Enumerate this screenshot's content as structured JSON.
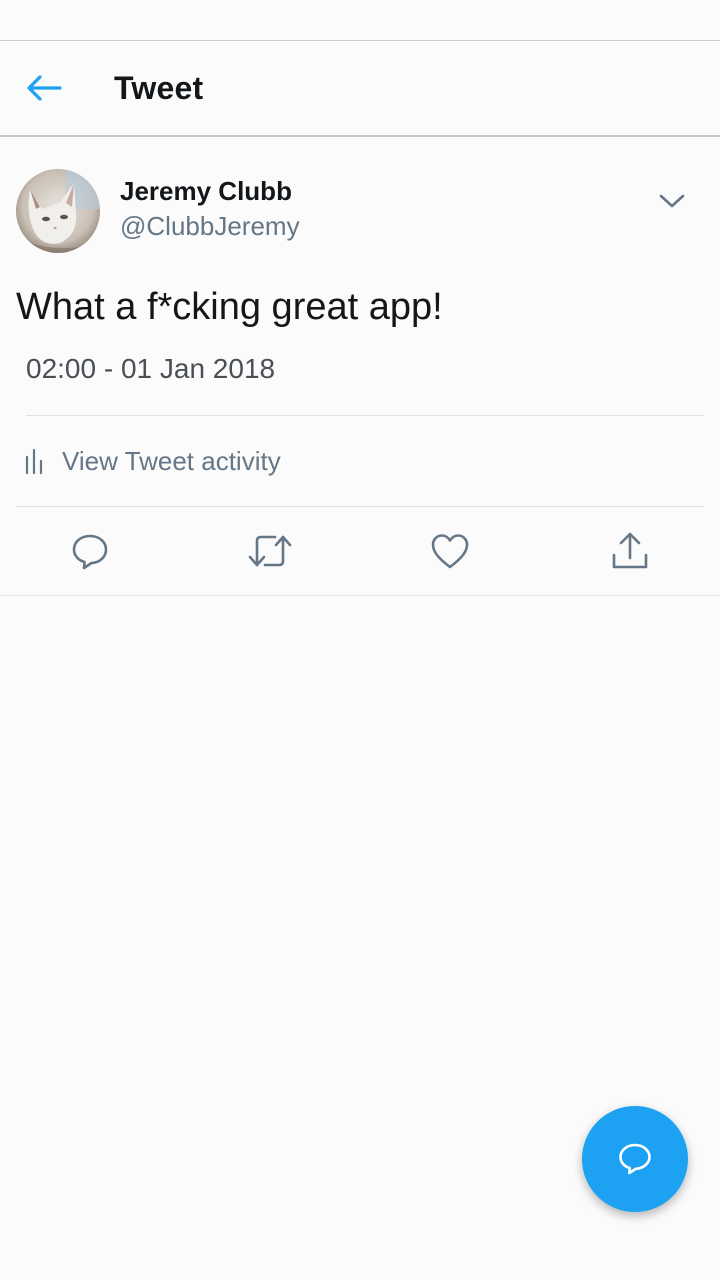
{
  "header": {
    "title": "Tweet",
    "back_icon": "arrow-left-icon"
  },
  "tweet": {
    "author": {
      "display_name": "Jeremy Clubb",
      "handle": "@ClubbJeremy"
    },
    "text": "What a f*cking great app!",
    "timestamp": "02:00 - 01 Jan 2018",
    "activity_label": "View Tweet activity",
    "actions": [
      {
        "name": "reply",
        "icon": "reply-icon"
      },
      {
        "name": "retweet",
        "icon": "retweet-icon"
      },
      {
        "name": "like",
        "icon": "heart-icon"
      },
      {
        "name": "share",
        "icon": "share-icon"
      }
    ]
  },
  "fab": {
    "icon": "compose-reply-icon"
  },
  "colors": {
    "accent": "#1da1f2",
    "primary_text": "#14171a",
    "secondary_text": "#657786",
    "background": "#fbfbfc"
  }
}
